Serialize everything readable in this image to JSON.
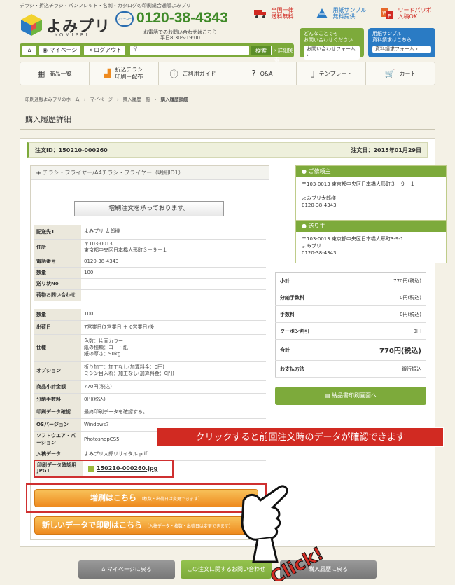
{
  "header": {
    "tagline": "チラシ・折込チラシ・パンフレット・名刺・カタログの印刷総合通販よみプリ",
    "logo_text": "よみプリ",
    "logo_sub": "YOMIPRI",
    "phone_badge": "フリーコール",
    "phone": "0120-38-4343",
    "phone_note1": "お電話でのお問い合わせはこちら",
    "phone_note2": "平日8:30〜19:00",
    "shipping_line1": "全国一律",
    "shipping_line2": "送料無料",
    "sample_line1": "用紙サンプル",
    "sample_line2": "無料提供",
    "word_line1": "ワードパワポ",
    "word_line2": "入稿OK",
    "contact_btn_line1": "どんなことでも",
    "contact_btn_line2": "お問い合わせください",
    "contact_btn_inner": "お問い合わせフォーム ›",
    "sample_btn_line1": "用紙サンプル",
    "sample_btn_line2": "資料請求はこちら",
    "sample_btn_inner": "資料請求フォーム ›"
  },
  "userbar": {
    "mypage": "マイページ",
    "logout": "ログアウト",
    "search_placeholder": "",
    "search_button": "検索",
    "advanced": "› 詳細検索"
  },
  "nav": [
    {
      "label": "商品一覧"
    },
    {
      "label": "折込チラシ\n印刷＋配布"
    },
    {
      "label": "ご利用ガイド"
    },
    {
      "label": "Q&A"
    },
    {
      "label": "テンプレート"
    },
    {
      "label": "カート"
    }
  ],
  "breadcrumb": [
    "印刷通販よみプリのホーム",
    "›",
    "マイページ",
    "›",
    "購入履歴一覧",
    "›",
    "購入履歴詳細"
  ],
  "page_title": "購入履歴詳細",
  "order": {
    "id_label": "注文ID：150210-000260",
    "date_label": "注文日：2015年01月29日",
    "item_title": "チラシ・フライヤー/A4チラシ・フライヤー（明細ID1）",
    "notice": "増刷注文を承っております。",
    "shipping_rows": [
      {
        "k": "配送先1",
        "v": "よみプリ 太郎様"
      },
      {
        "k": "住所",
        "v": "〒103-0013\n東京都中央区日本橋人形町３－９－１"
      },
      {
        "k": "電話番号",
        "v": "0120-38-4343"
      },
      {
        "k": "数量",
        "v": "100"
      },
      {
        "k": "送り状No",
        "v": ""
      },
      {
        "k": "荷物お問い合わせ",
        "v": ""
      }
    ],
    "spec_rows": [
      {
        "k": "数量",
        "v": "100"
      },
      {
        "k": "出荷日",
        "v": "7営業日(7営業日 ＋ 0営業日)後"
      },
      {
        "k": "仕様",
        "v": "色数：片面カラー\n紙の種類：コート紙\n紙の厚さ：90kg"
      },
      {
        "k": "オプション",
        "v": "折り加工：加工なし(加算料金：0円)\nミシン目入れ：加工なし(加算料金：0円)"
      },
      {
        "k": "商品小計金額",
        "v": "770円(税込)"
      },
      {
        "k": "分納手数料",
        "v": "0円(税込)"
      },
      {
        "k": "印刷データ確認",
        "v": "最終印刷データを確認する。"
      },
      {
        "k": "OSバージョン",
        "v": "Windows7"
      },
      {
        "k": "ソフトウエア・バージョン",
        "v": "PhotoshopCS5"
      },
      {
        "k": "入稿データ",
        "v": "よみプリ太郎リサイタル.pdf"
      }
    ],
    "file_label": "印刷データ確認用JPG1",
    "file_name": "150210-000260.jpg",
    "reprint_label": "増刷はこちら",
    "reprint_note": "（枚数・出荷日は変更できます）",
    "newdata_label": "新しいデータで印刷はこちら",
    "newdata_note": "（入稿データ・枚数・出荷日は変更できます）"
  },
  "callout": "クリックすると前回注文時のデータが確認できます",
  "client": {
    "header": "ご依頼主",
    "line1": "〒103-0013 東京都中央区日本橋人形町３－９－１",
    "line2": "よみプリ太郎様",
    "line3": "0120-38-4343"
  },
  "sender": {
    "header": "送り主",
    "line1": "〒103-0013 東京都中央区日本橋人形町3-9-1",
    "line2": "よみプリ",
    "line3": "0120-38-4343"
  },
  "summary": [
    {
      "k": "小計",
      "v": "770円(税込)"
    },
    {
      "k": "分納手数料",
      "v": "0円(税込)"
    },
    {
      "k": "手数料",
      "v": "0円(税込)"
    },
    {
      "k": "クーポン割引",
      "v": "0円"
    },
    {
      "k": "合計",
      "v": "770円(税込)"
    },
    {
      "k": "お支払方法",
      "v": "銀行振込"
    }
  ],
  "slip_button": "納品書印刷画面へ",
  "bottom": {
    "back_mypage": "マイページに戻る",
    "inquiry": "この注文に関するお問い合わせ",
    "back_history": "購入履歴に戻る"
  },
  "click_text": "Click!",
  "colors": {
    "accent": "#7daa3b",
    "orange": "#ee8a1e",
    "red": "#d12a22"
  }
}
